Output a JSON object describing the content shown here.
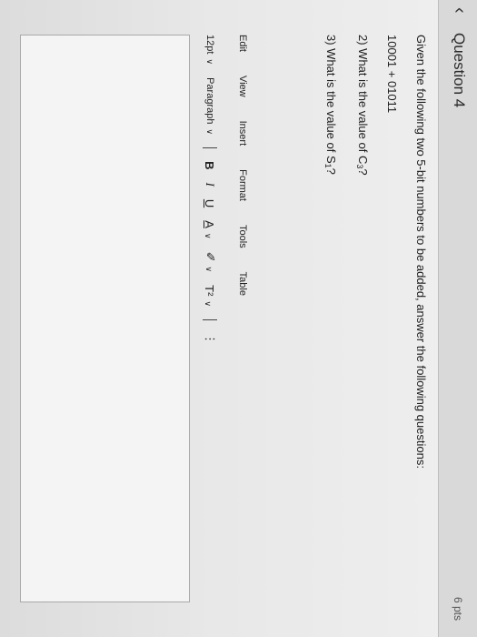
{
  "question": {
    "title": "Question 4",
    "points": "6 pts",
    "prompt": "Given the following two 5-bit numbers to be added, answer the following questions:",
    "numbers": "10001 + 01011",
    "q2_prefix": "2) What is the value of C",
    "q2_sub": "3",
    "q2_suffix": "?",
    "q3_prefix": "3) What is the value of S",
    "q3_sub": "1",
    "q3_suffix": "?"
  },
  "menubar": {
    "items": [
      "Edit",
      "View",
      "Insert",
      "Format",
      "Tools",
      "Table"
    ]
  },
  "toolbar": {
    "font_size": "12pt",
    "block_format": "Paragraph",
    "bold": "B",
    "italic": "I",
    "underline": "U",
    "text_color": "A",
    "highlight": "✐",
    "superscript": "T²",
    "more": "⋮",
    "dropdown": "∨"
  },
  "icons": {
    "collapse": "chevron-left-icon"
  }
}
